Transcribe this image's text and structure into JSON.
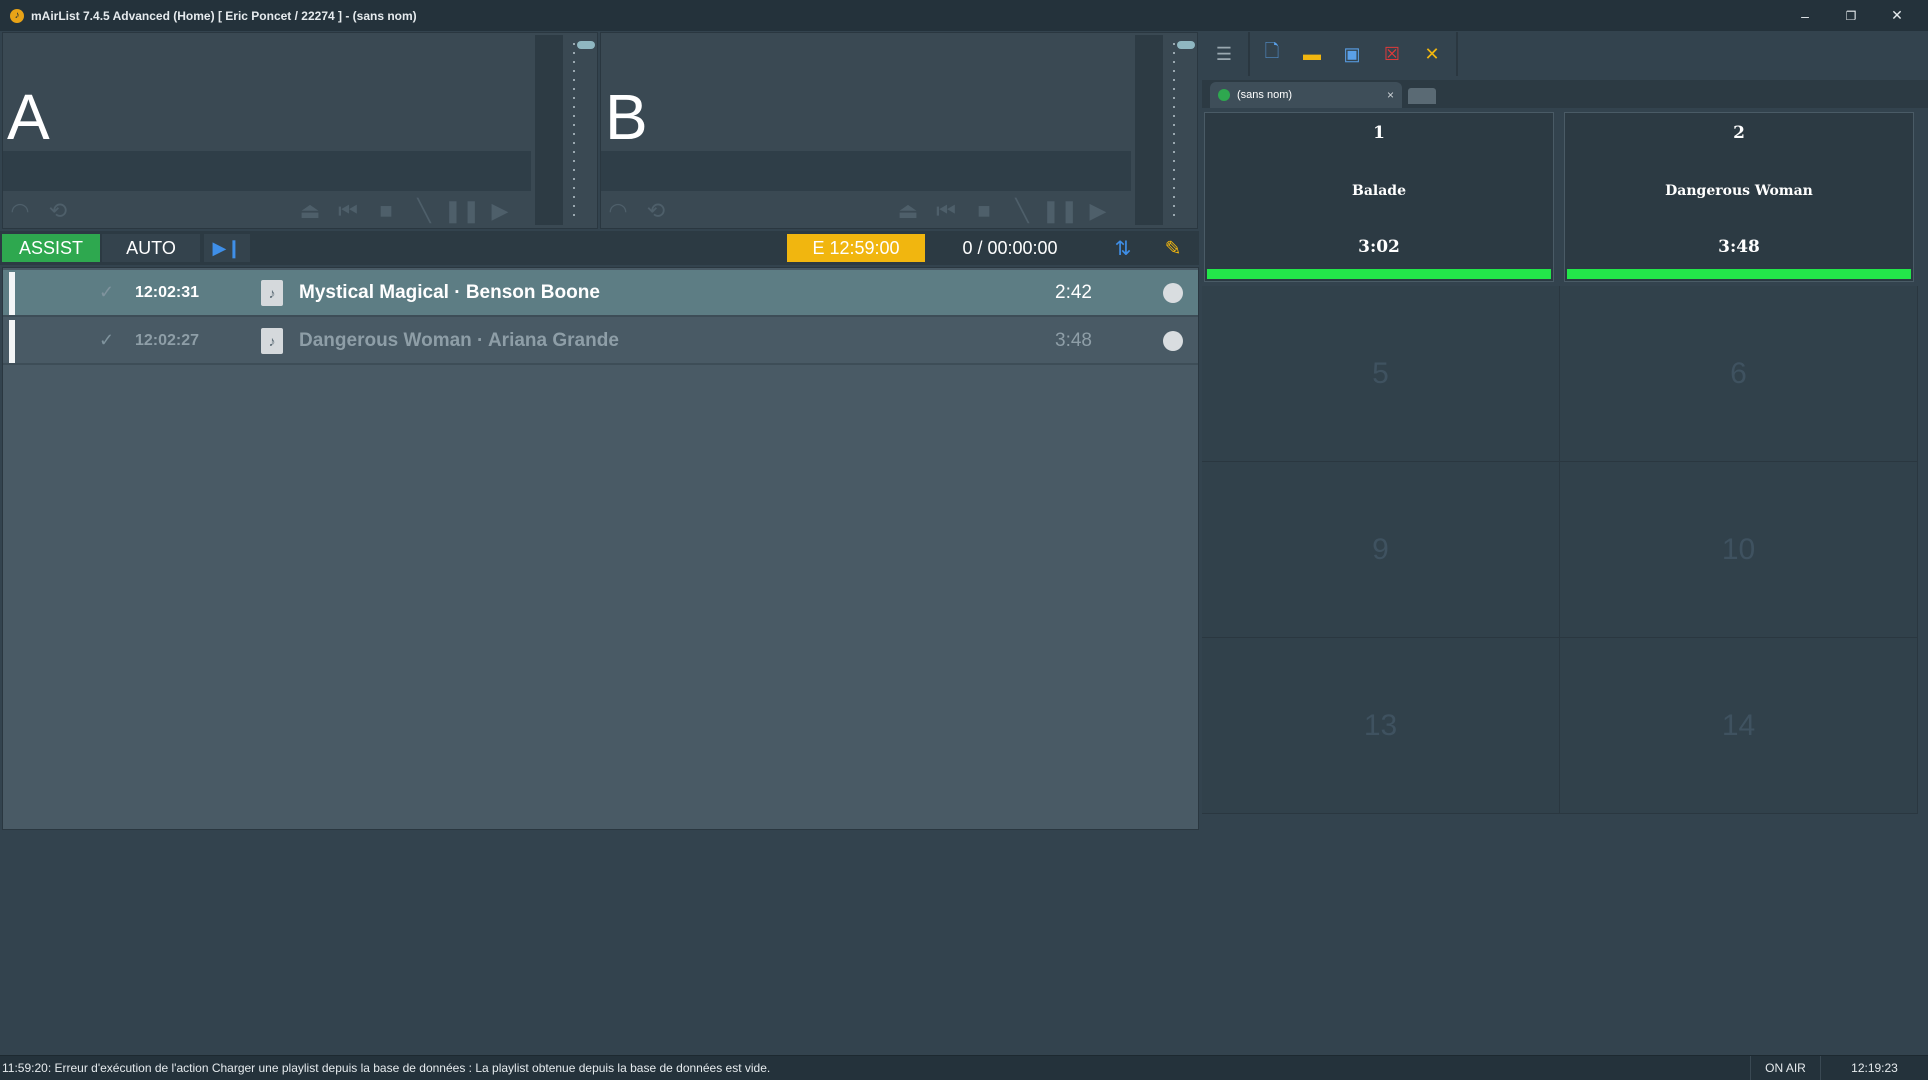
{
  "window": {
    "title": "mAirList 7.4.5 Advanced (Home) [ Eric Poncet / 22274 ] - (sans nom)",
    "minimize": "–",
    "restore": "❐",
    "close": "✕"
  },
  "players": [
    {
      "letter": "A"
    },
    {
      "letter": "B"
    }
  ],
  "controls": {
    "assist_label": "ASSIST",
    "auto_label": "AUTO",
    "end_time": "E  12:59:00",
    "count_time": "0 / 00:00:00"
  },
  "playlist": {
    "rows": [
      {
        "time": "12:02:31",
        "title": "Mystical Magical · Benson Boone",
        "duration": "2:42",
        "state": "active"
      },
      {
        "time": "12:02:27",
        "title": "Dangerous Woman · Ariana Grande",
        "duration": "3:48",
        "state": "played"
      }
    ]
  },
  "cartwall": {
    "tab_label": "(sans nom)",
    "tab_close": "×",
    "carts": [
      {
        "number": "1",
        "name": "Balade",
        "duration": "3:02"
      },
      {
        "number": "2",
        "name": "Dangerous Woman",
        "duration": "3:48"
      }
    ],
    "empty_slots": [
      "5",
      "6",
      "9",
      "10",
      "13",
      "14"
    ]
  },
  "statusbar": {
    "message": "11:59:20: Erreur d'exécution de l'action Charger une playlist depuis la base de données : La playlist obtenue depuis la base de données est vide.",
    "onair": "ON AIR",
    "clock": "12:19:23"
  },
  "colors": {
    "assist_green": "#2ea84f",
    "end_time_yellow": "#f1b60f",
    "cart_progress_green": "#23e64a",
    "accent_blue": "#3f8fe8"
  }
}
